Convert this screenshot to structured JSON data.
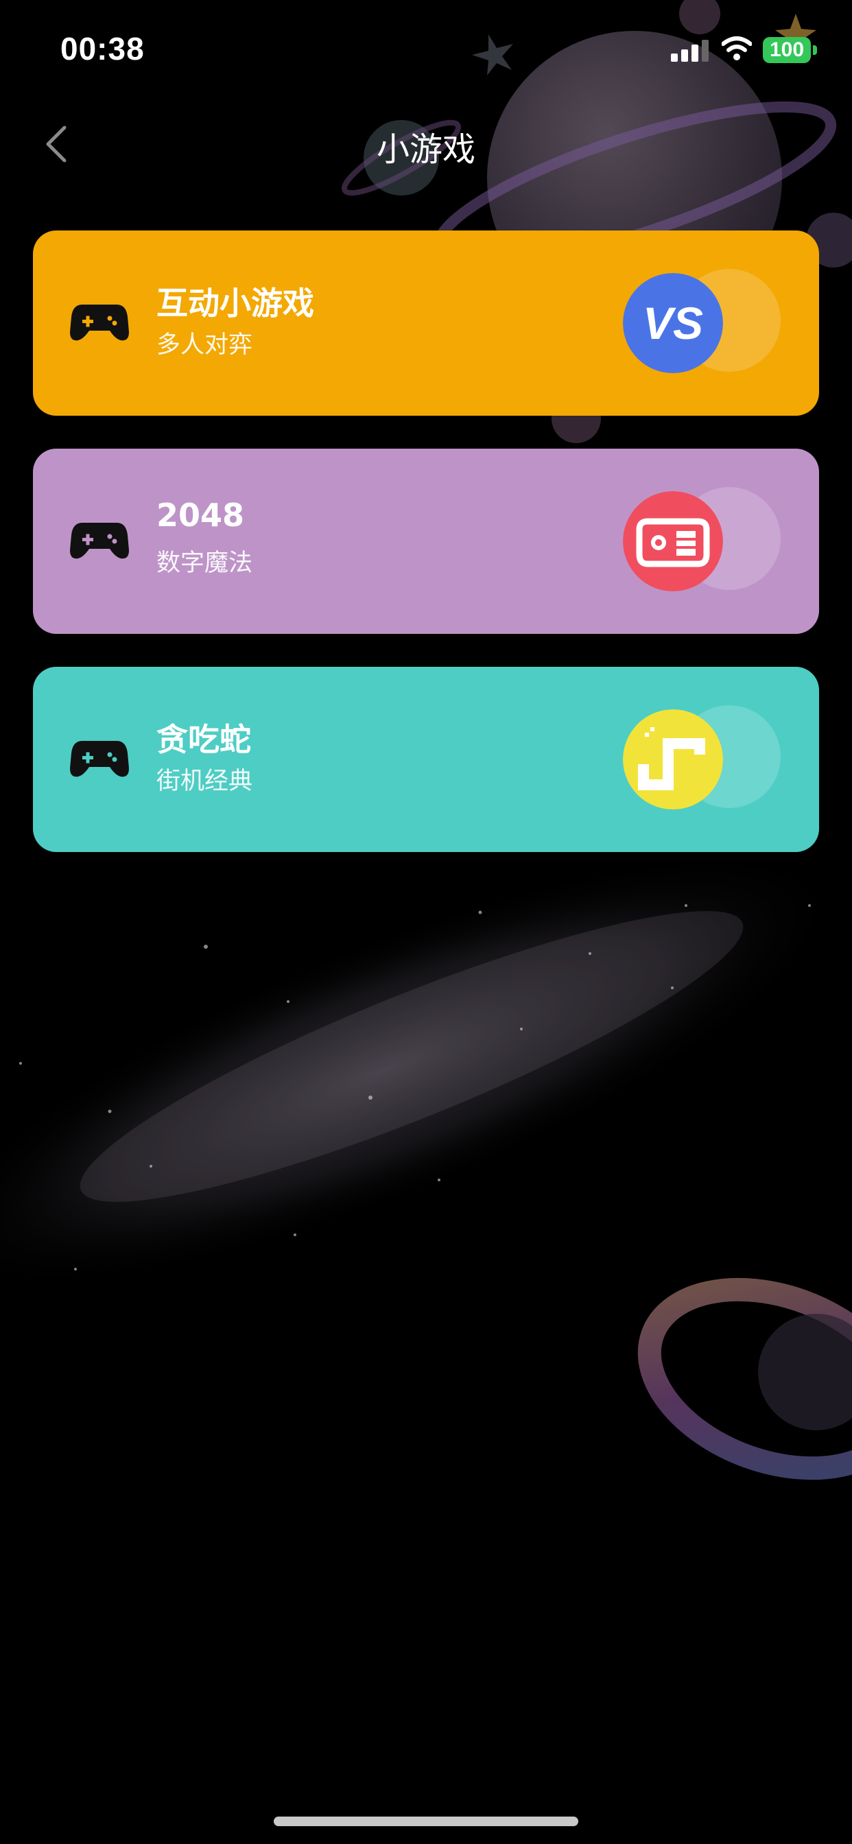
{
  "status_bar": {
    "time": "00:38",
    "battery": "100"
  },
  "nav": {
    "title": "小游戏"
  },
  "games": [
    {
      "title": "互动小游戏",
      "subtitle": "多人对弈",
      "color": "#f3a804",
      "badge_color": "#4a74e6",
      "badge_icon": "vs-icon",
      "badge_text": "VS"
    },
    {
      "title": "2048",
      "subtitle": "数字魔法",
      "color": "#be94c8",
      "badge_color": "#f04e5e",
      "badge_icon": "game-controller-badge-icon"
    },
    {
      "title": "贪吃蛇",
      "subtitle": "街机经典",
      "color": "#4ecdc4",
      "badge_color": "#f2e33a",
      "badge_icon": "snake-icon"
    }
  ],
  "colors": {
    "background": "#000000",
    "battery": "#34c759"
  }
}
